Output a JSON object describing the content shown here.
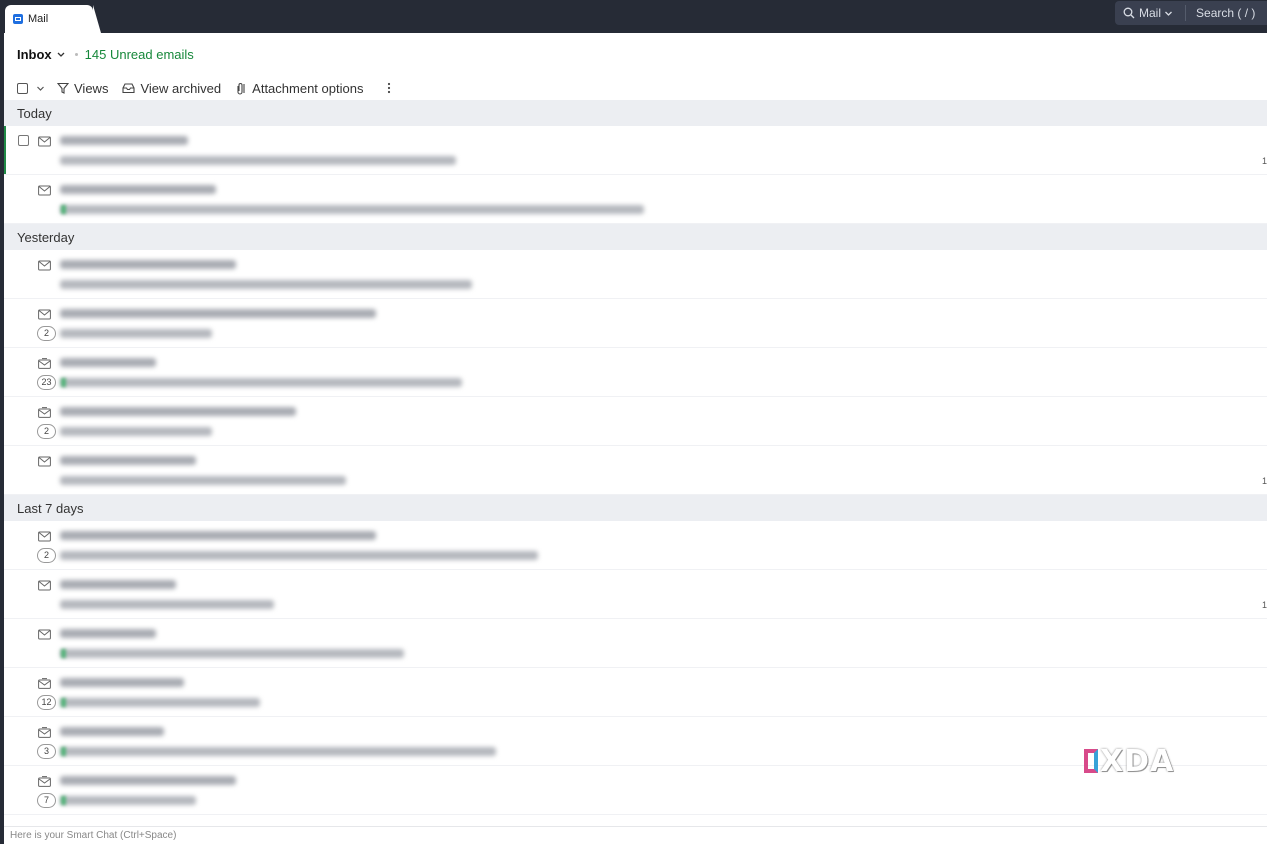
{
  "app": {
    "tab_label": "Mail",
    "search_scope": "Mail",
    "search_hint": "Search ( / )"
  },
  "header": {
    "folder": "Inbox",
    "unread": "145 Unread emails"
  },
  "toolbar": {
    "views": "Views",
    "view_archived": "View archived",
    "attachment_options": "Attachment options"
  },
  "groups": [
    {
      "label": "Today",
      "rows": [
        {
          "checkbox": true,
          "icon": "envelope-icon",
          "count": "",
          "edge": "1",
          "tag": false
        },
        {
          "checkbox": false,
          "icon": "envelope-icon",
          "count": "",
          "edge": "",
          "tag": true
        }
      ]
    },
    {
      "label": "Yesterday",
      "rows": [
        {
          "checkbox": false,
          "icon": "envelope-icon",
          "count": "",
          "edge": "",
          "tag": false
        },
        {
          "checkbox": false,
          "icon": "envelope-icon",
          "count": "2",
          "edge": "",
          "tag": false
        },
        {
          "checkbox": false,
          "icon": "envelope-open-icon",
          "count": "23",
          "edge": "",
          "tag": true
        },
        {
          "checkbox": false,
          "icon": "envelope-open-icon",
          "count": "2",
          "edge": "",
          "tag": false
        },
        {
          "checkbox": false,
          "icon": "envelope-icon",
          "count": "",
          "edge": "1",
          "tag": false
        }
      ]
    },
    {
      "label": "Last 7 days",
      "rows": [
        {
          "checkbox": false,
          "icon": "envelope-icon",
          "count": "2",
          "edge": "",
          "tag": false
        },
        {
          "checkbox": false,
          "icon": "envelope-icon",
          "count": "",
          "edge": "1",
          "tag": false
        },
        {
          "checkbox": false,
          "icon": "envelope-icon",
          "count": "",
          "edge": "",
          "tag": true
        },
        {
          "checkbox": false,
          "icon": "envelope-open-icon",
          "count": "12",
          "edge": "",
          "tag": true
        },
        {
          "checkbox": false,
          "icon": "envelope-open-icon",
          "count": "3",
          "edge": "",
          "tag": true
        },
        {
          "checkbox": false,
          "icon": "envelope-open-icon",
          "count": "7",
          "edge": "",
          "tag": true
        }
      ]
    }
  ],
  "watermark": "XDA",
  "footer": {
    "smart_chat_hint": "Here is your Smart Chat (Ctrl+Space)"
  },
  "colors": {
    "topbar": "#262b36",
    "unread_accent": "#17883b",
    "group_header_bg": "#eceef2"
  }
}
